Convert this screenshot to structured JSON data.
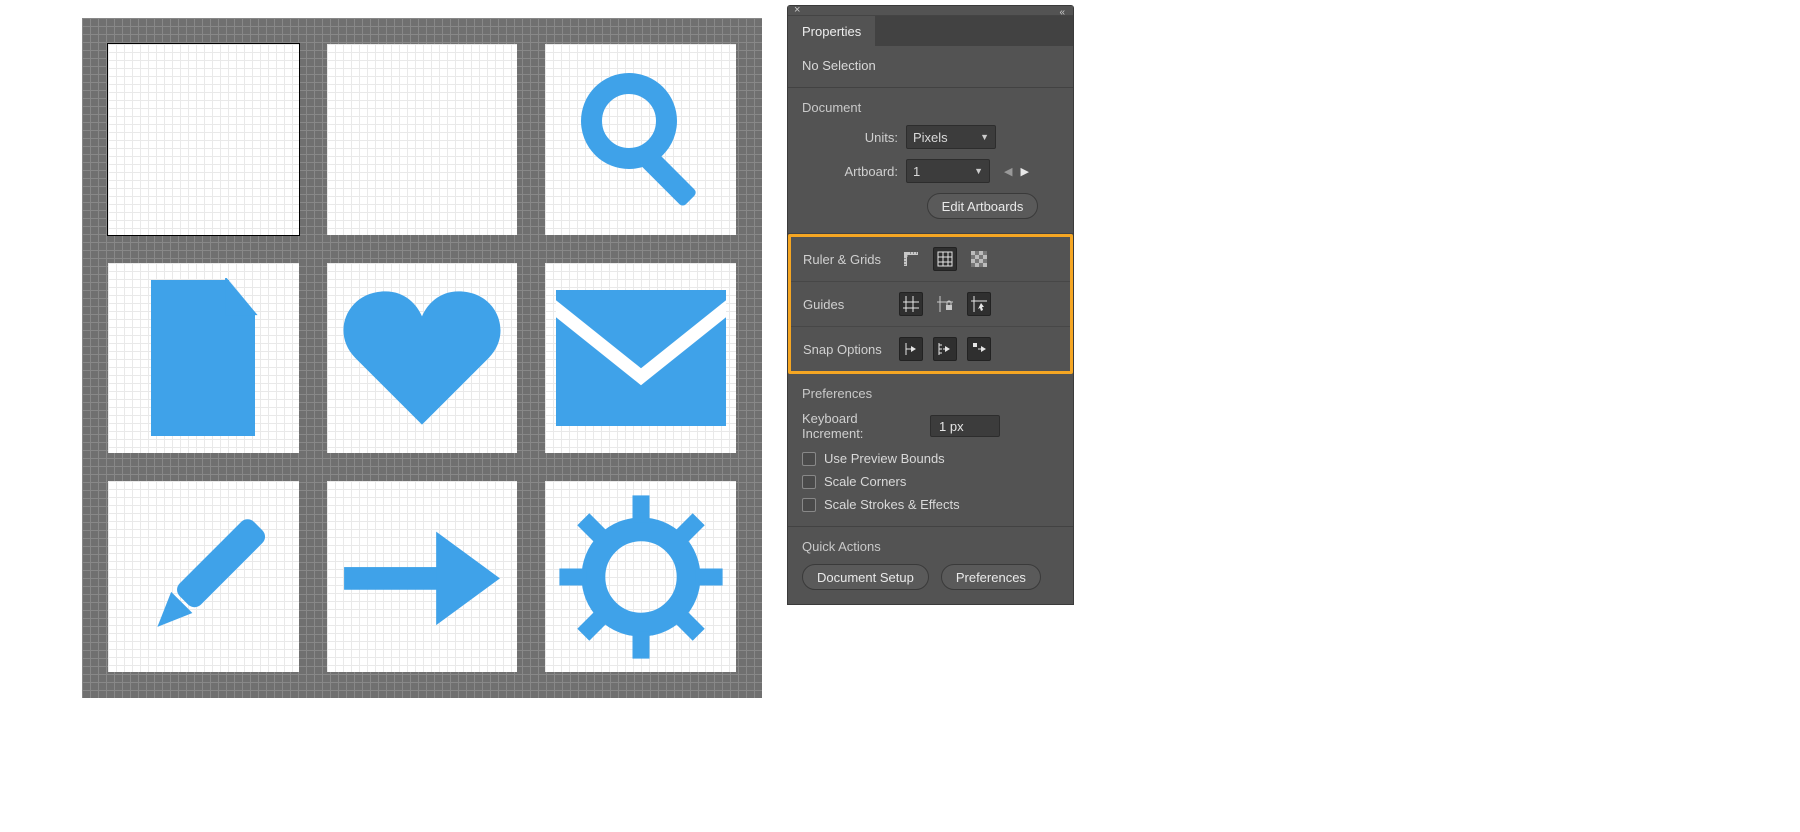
{
  "panel": {
    "tab_label": "Properties",
    "selection_status": "No Selection",
    "document": {
      "heading": "Document",
      "units_label": "Units:",
      "units_value": "Pixels",
      "artboard_label": "Artboard:",
      "artboard_value": "1",
      "edit_artboards_label": "Edit Artboards"
    },
    "ruler_grids_label": "Ruler & Grids",
    "guides_label": "Guides",
    "snap_options_label": "Snap Options",
    "preferences": {
      "heading": "Preferences",
      "keyboard_increment_label": "Keyboard Increment:",
      "keyboard_increment_value": "1 px",
      "use_preview_bounds_label": "Use Preview Bounds",
      "scale_corners_label": "Scale Corners",
      "scale_strokes_label": "Scale Strokes & Effects"
    },
    "quick_actions": {
      "heading": "Quick Actions",
      "document_setup_label": "Document Setup",
      "preferences_label": "Preferences"
    }
  },
  "artboards": [
    {
      "icon": "none",
      "selected": true
    },
    {
      "icon": "none",
      "selected": false
    },
    {
      "icon": "search",
      "selected": false
    },
    {
      "icon": "document",
      "selected": false
    },
    {
      "icon": "heart",
      "selected": false
    },
    {
      "icon": "envelope",
      "selected": false
    },
    {
      "icon": "pencil",
      "selected": false
    },
    {
      "icon": "arrow",
      "selected": false
    },
    {
      "icon": "gear",
      "selected": false
    }
  ],
  "colors": {
    "icon_blue": "#3fa2e9",
    "highlight_orange": "#f5a623"
  }
}
